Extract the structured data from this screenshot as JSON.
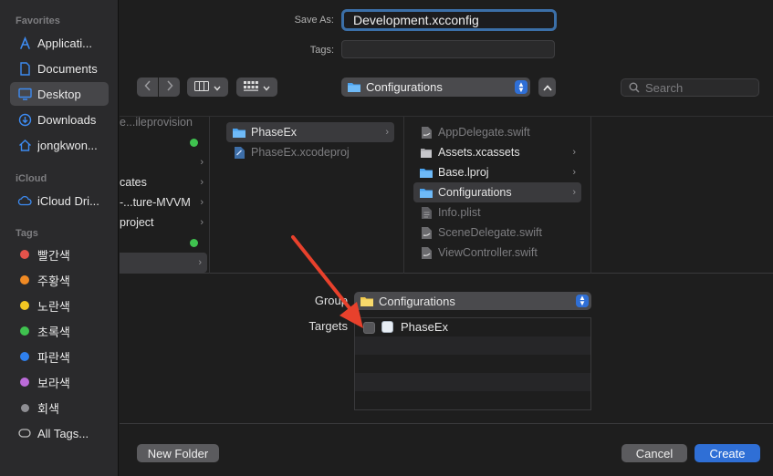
{
  "sidebar": {
    "favorites_header": "Favorites",
    "favorites": [
      {
        "label": "Applicati...",
        "icon": "applications-icon"
      },
      {
        "label": "Documents",
        "icon": "document-icon"
      },
      {
        "label": "Desktop",
        "icon": "desktop-icon",
        "selected": true
      },
      {
        "label": "Downloads",
        "icon": "downloads-icon"
      },
      {
        "label": "jongkwon...",
        "icon": "home-icon"
      }
    ],
    "icloud_header": "iCloud",
    "icloud": [
      {
        "label": "iCloud Dri...",
        "icon": "cloud-icon"
      }
    ],
    "tags_header": "Tags",
    "tags": [
      {
        "label": "빨간색",
        "color": "#e5534b"
      },
      {
        "label": "주황색",
        "color": "#f08a24"
      },
      {
        "label": "노란색",
        "color": "#f3c623"
      },
      {
        "label": "초록색",
        "color": "#3fc24f"
      },
      {
        "label": "파란색",
        "color": "#2f80ed"
      },
      {
        "label": "보라색",
        "color": "#bb6bd9"
      },
      {
        "label": "회색",
        "color": "#8e8e93"
      },
      {
        "label": "All Tags...",
        "color": ""
      }
    ]
  },
  "save": {
    "save_as_label": "Save As:",
    "save_as_value": "Development.xcconfig",
    "tags_label": "Tags:",
    "tags_value": ""
  },
  "toolbar": {
    "back_icon": "chevron-left-icon",
    "forward_icon": "chevron-right-icon",
    "location": "Configurations",
    "search_placeholder": "Search"
  },
  "browser": {
    "col1": [
      {
        "label": "e...ileprovision",
        "dim": true
      },
      {
        "label": "",
        "dot": true
      },
      {
        "label": "",
        "arrow": true
      },
      {
        "label": "cates",
        "arrow": true
      },
      {
        "label": "-...ture-MVVM",
        "arrow": true
      },
      {
        "label": "project",
        "arrow": true
      },
      {
        "label": "",
        "dot": true
      },
      {
        "label": "",
        "arrow": true,
        "selected": true
      }
    ],
    "col2": [
      {
        "label": "PhaseEx",
        "icon": "folder-icon",
        "arrow": true,
        "selected": true
      },
      {
        "label": "PhaseEx.xcodeproj",
        "icon": "xcodeproj-icon",
        "dim": true
      }
    ],
    "col3": [
      {
        "label": "AppDelegate.swift",
        "icon": "swift-file-icon",
        "dim": true
      },
      {
        "label": "Assets.xcassets",
        "icon": "assets-icon",
        "arrow": true
      },
      {
        "label": "Base.lproj",
        "icon": "folder-icon",
        "arrow": true
      },
      {
        "label": "Configurations",
        "icon": "folder-icon",
        "arrow": true,
        "selected": true
      },
      {
        "label": "Info.plist",
        "icon": "plist-file-icon",
        "dim": true
      },
      {
        "label": "SceneDelegate.swift",
        "icon": "swift-file-icon",
        "dim": true
      },
      {
        "label": "ViewController.swift",
        "icon": "swift-file-icon",
        "dim": true
      }
    ]
  },
  "options": {
    "group_label": "Group",
    "group_value": "Configurations",
    "targets_label": "Targets",
    "targets": [
      {
        "name": "PhaseEx",
        "checked": false
      }
    ]
  },
  "buttons": {
    "new_folder": "New Folder",
    "cancel": "Cancel",
    "create": "Create"
  },
  "colors": {
    "accent": "#2f6fd6",
    "annotation_arrow": "#e8412c"
  }
}
